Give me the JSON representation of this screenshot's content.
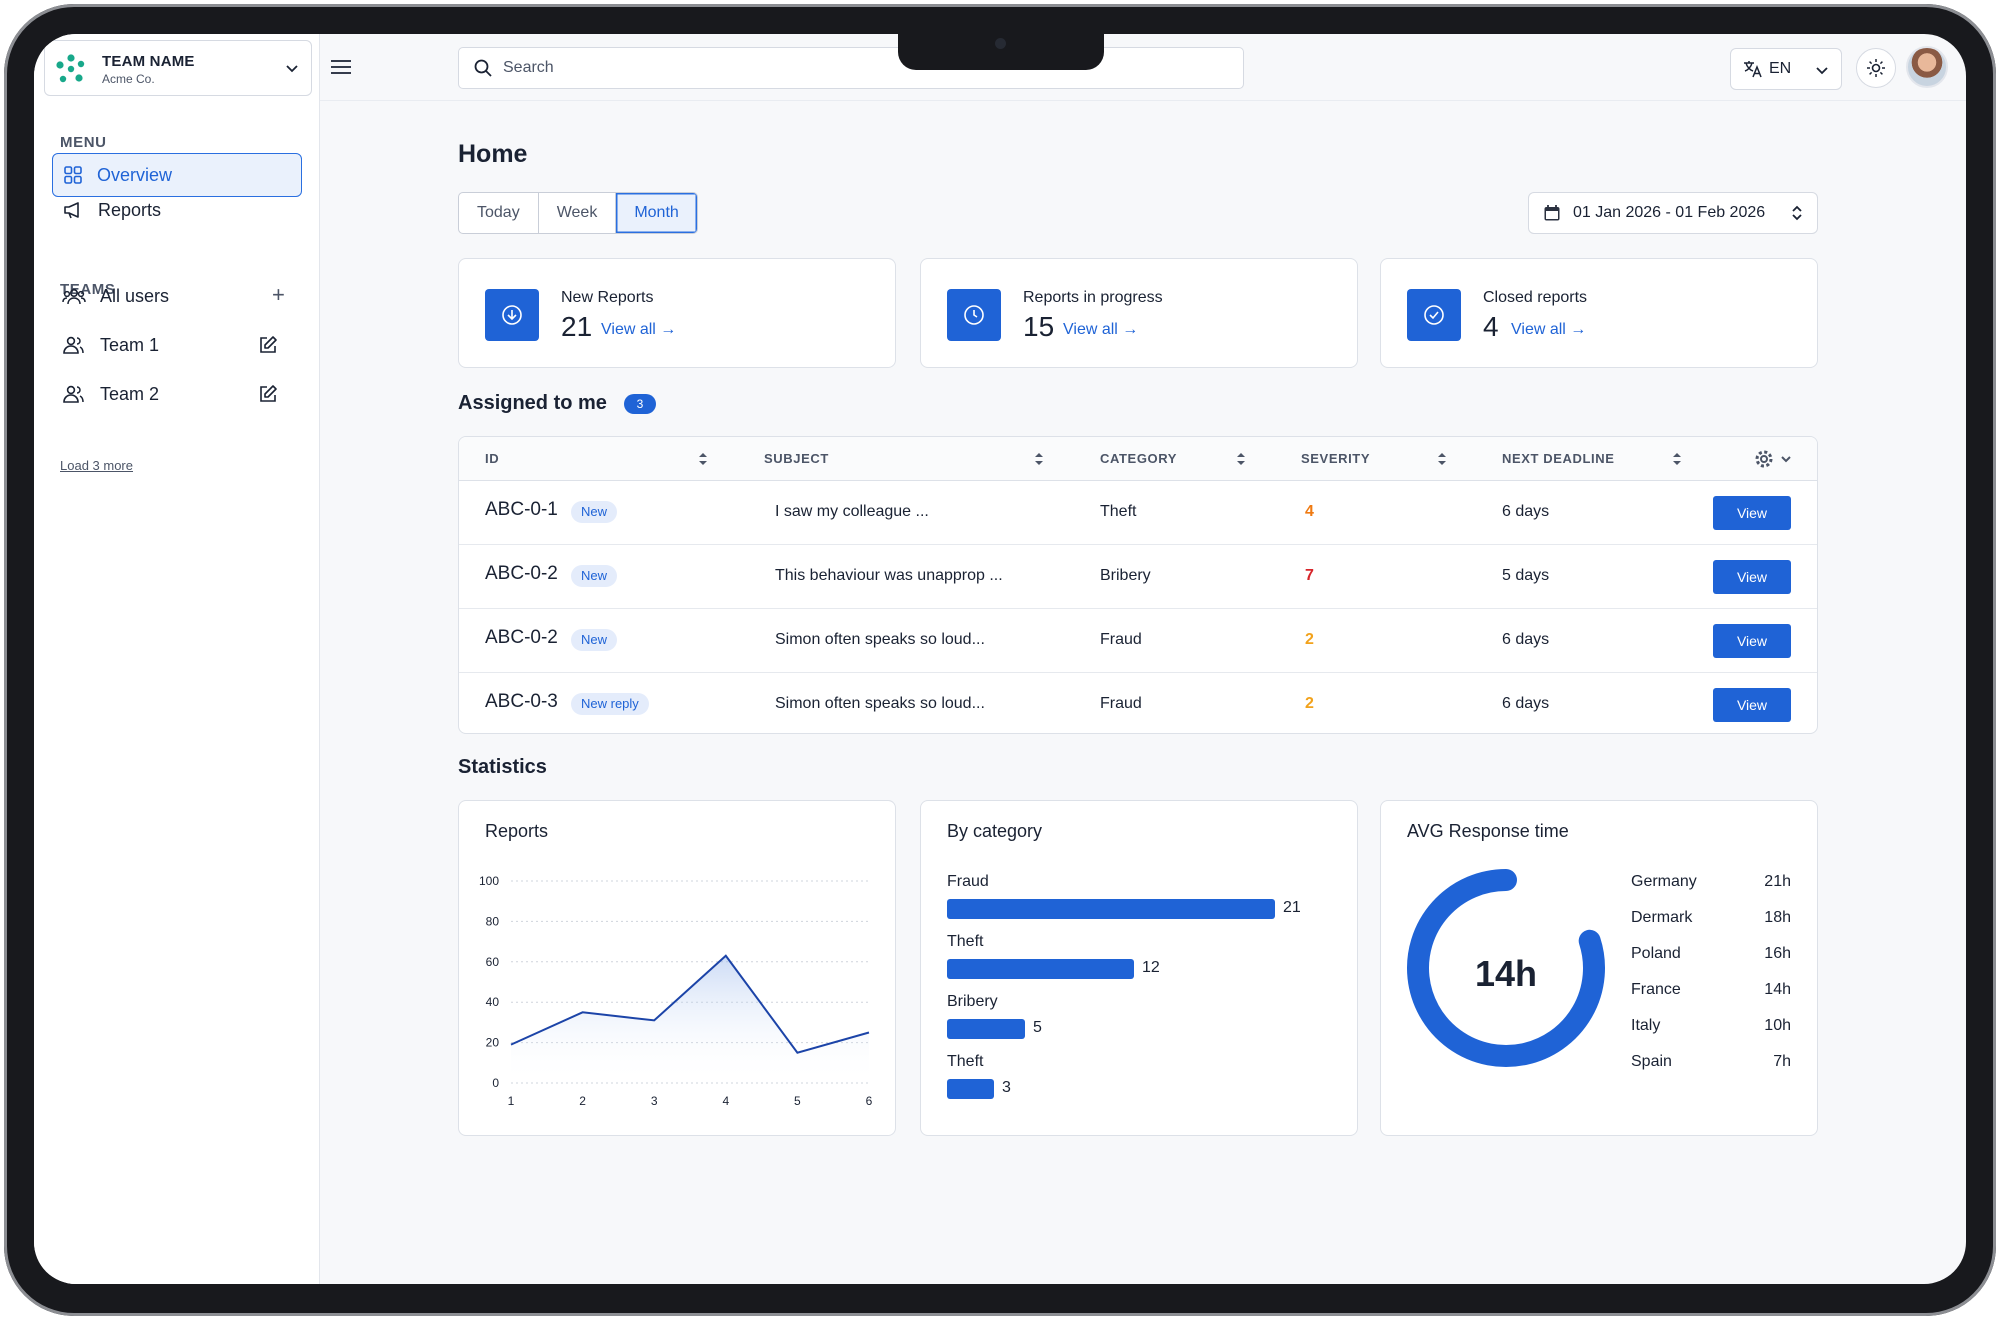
{
  "team": {
    "name": "TEAM NAME",
    "org": "Acme Co."
  },
  "sidebar": {
    "menu_label": "MENU",
    "menu": [
      {
        "label": "Overview",
        "active": true
      },
      {
        "label": "Reports",
        "active": false
      }
    ],
    "teams_label": "TEAMS",
    "teams": [
      {
        "label": "All users"
      },
      {
        "label": "Team 1"
      },
      {
        "label": "Team 2"
      }
    ],
    "load_more": "Load 3 more"
  },
  "search": {
    "placeholder": "Search"
  },
  "language": "EN",
  "page": {
    "title": "Home",
    "periods": [
      "Today",
      "Week",
      "Month"
    ],
    "selected_period": "Month",
    "date_range": "01 Jan 2026 - 01 Feb 2026"
  },
  "kpis": [
    {
      "label": "New Reports",
      "value": "21",
      "link": "View all →"
    },
    {
      "label": "Reports in progress",
      "value": "15",
      "link": "View all →"
    },
    {
      "label": "Closed reports",
      "value": "4",
      "link": "View all →"
    }
  ],
  "assigned": {
    "title": "Assigned to me",
    "count": "3",
    "columns": [
      "ID",
      "SUBJECT",
      "CATEGORY",
      "SEVERITY",
      "NEXT DEADLINE"
    ],
    "rows": [
      {
        "id": "ABC-0-1",
        "tag": "New",
        "subject": "I saw my colleague ...",
        "category": "Theft",
        "severity": "4",
        "severity_color": "#ef7a12",
        "deadline": "6 days",
        "action": "View"
      },
      {
        "id": "ABC-0-2",
        "tag": "New",
        "subject": "This behaviour was unapprop ...",
        "category": "Bribery",
        "severity": "7",
        "severity_color": "#d7262b",
        "deadline": "5 days",
        "action": "View"
      },
      {
        "id": "ABC-0-2",
        "tag": "New",
        "subject": "Simon often speaks so loud...",
        "category": "Fraud",
        "severity": "2",
        "severity_color": "#f2a21b",
        "deadline": "6 days",
        "action": "View"
      },
      {
        "id": "ABC-0-3",
        "tag": "New reply",
        "subject": "Simon often speaks so loud...",
        "category": "Fraud",
        "severity": "2",
        "severity_color": "#f2a21b",
        "deadline": "6 days",
        "action": "View"
      }
    ]
  },
  "statistics": {
    "title": "Statistics",
    "reports_title": "Reports",
    "category_title": "By category",
    "response_title": "AVG Response time",
    "response_value": "14h",
    "response_fraction": 0.8,
    "countries": [
      {
        "name": "Germany",
        "value": "21h"
      },
      {
        "name": "Dermark",
        "value": "18h"
      },
      {
        "name": "Poland",
        "value": "16h"
      },
      {
        "name": "France",
        "value": "14h"
      },
      {
        "name": "Italy",
        "value": "10h"
      },
      {
        "name": "Spain",
        "value": "7h"
      }
    ]
  },
  "colors": {
    "accent": "#1f63d6",
    "chart_line": "#1c44a8",
    "teal_logo": "#18a88a"
  },
  "chart_data": [
    {
      "type": "line",
      "title": "Reports",
      "x": [
        1,
        2,
        3,
        4,
        5,
        6
      ],
      "series": [
        {
          "values": [
            19,
            35,
            31,
            63,
            15,
            25
          ]
        }
      ],
      "ylim": [
        0,
        100
      ],
      "yticks": [
        0,
        20,
        40,
        60,
        80,
        100
      ],
      "grid": true
    },
    {
      "type": "bar",
      "title": "By category",
      "categories": [
        "Fraud",
        "Theft",
        "Bribery",
        "Theft"
      ],
      "values": [
        21,
        12,
        5,
        3
      ]
    }
  ]
}
